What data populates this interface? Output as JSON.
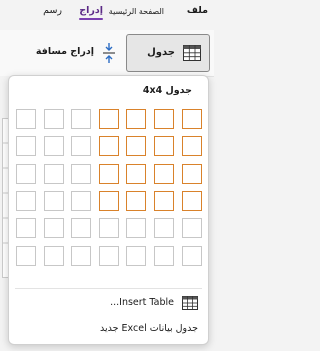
{
  "tabs": {
    "file": "ملف",
    "home": "الصفحة الرئيسية",
    "insert": "إدراج",
    "draw": "رسم"
  },
  "ribbon": {
    "table_label": "جدول",
    "spacing_label": "إدراج مسافة"
  },
  "dropdown": {
    "grid_size": "جدول 4x4",
    "grid": {
      "rows": 6,
      "cols": 7,
      "selected_rows": 4,
      "selected_cols": 4
    },
    "insert_table_label": "Insert Table...",
    "excel_table_label": "جدول بيانات Excel جديد"
  },
  "colors": {
    "accent": "#7a3fb0",
    "selection": "#d9822b"
  }
}
